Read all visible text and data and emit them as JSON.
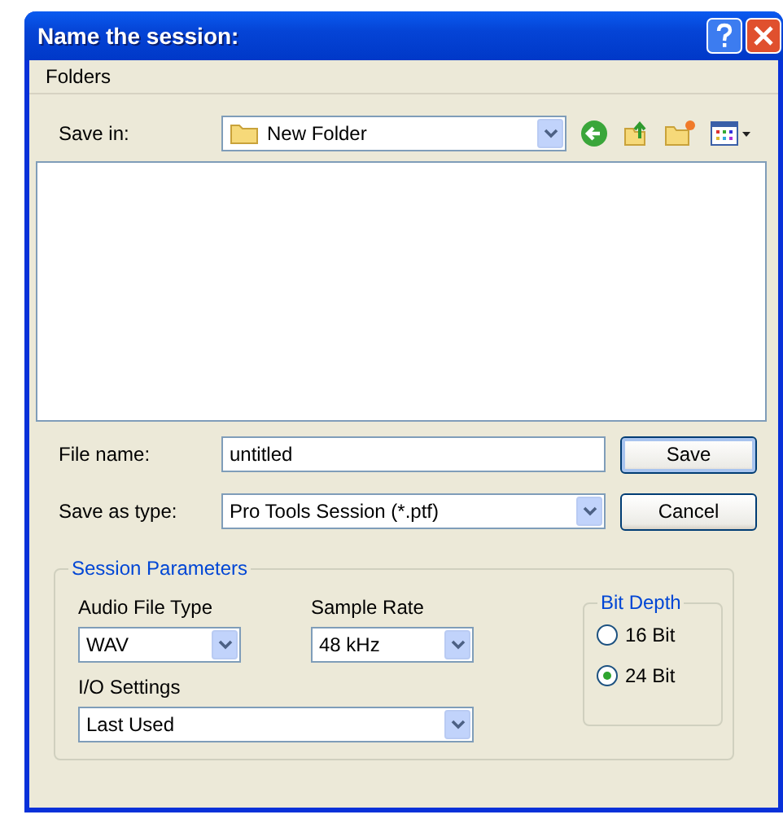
{
  "window": {
    "title": "Name the session:"
  },
  "menu": [
    "Folders"
  ],
  "save_in": {
    "label": "Save in:",
    "value": "New Folder"
  },
  "file_name": {
    "label": "File name:",
    "value": "untitled"
  },
  "save_as_type": {
    "label": "Save as type:",
    "value": "Pro Tools Session (*.ptf)"
  },
  "buttons": [
    "Save",
    "Cancel"
  ],
  "session_parameters": {
    "title": "Session Parameters",
    "audio_file_type": {
      "label": "Audio File Type",
      "value": "WAV"
    },
    "sample_rate": {
      "label": "Sample Rate",
      "value": "48 kHz"
    },
    "io_settings": {
      "label": "I/O Settings",
      "value": "Last Used"
    },
    "bit_depth": {
      "title": "Bit Depth",
      "options": [
        {
          "label": "16 Bit",
          "selected": false
        },
        {
          "label": "24 Bit",
          "selected": true
        }
      ]
    }
  }
}
